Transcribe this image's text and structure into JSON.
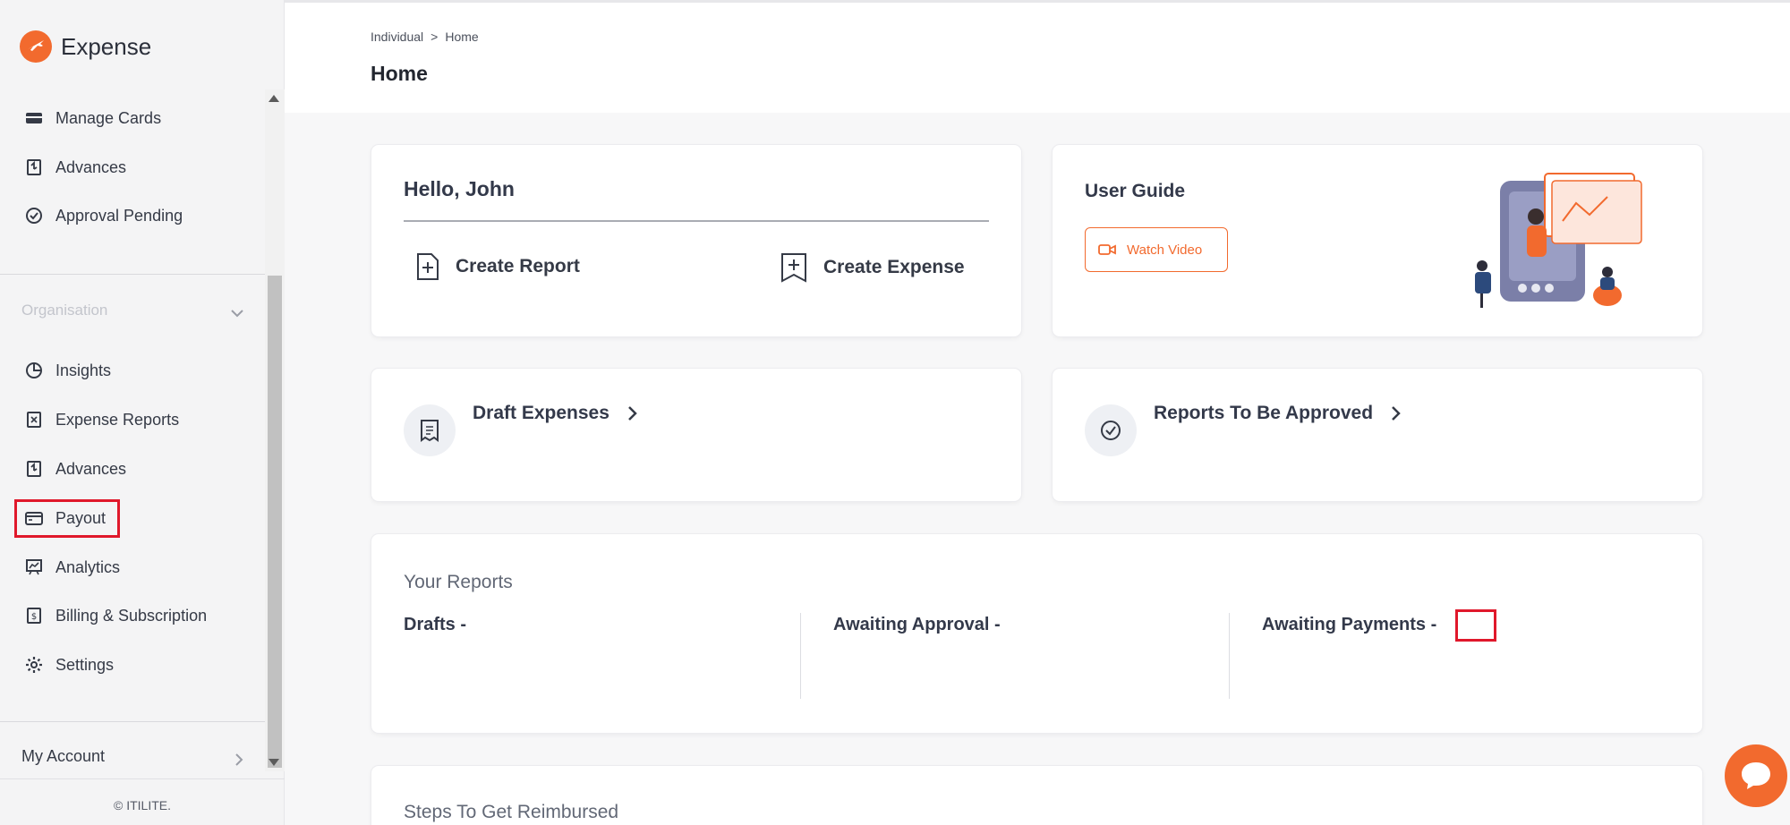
{
  "app": {
    "name": "Expense"
  },
  "sidebar": {
    "items_top": [
      {
        "label": "Manage Cards"
      },
      {
        "label": "Advances"
      },
      {
        "label": "Approval Pending"
      }
    ],
    "section_title": "Organisation",
    "items_org": [
      {
        "label": "Insights"
      },
      {
        "label": "Expense Reports"
      },
      {
        "label": "Advances"
      },
      {
        "label": "Payout"
      },
      {
        "label": "Analytics"
      },
      {
        "label": "Billing & Subscription"
      },
      {
        "label": "Settings"
      }
    ],
    "my_account": "My Account",
    "copyright": "© ITILITE."
  },
  "header": {
    "breadcrumb": [
      "Individual",
      ">",
      "Home"
    ],
    "title": "Home"
  },
  "hello_card": {
    "greeting": "Hello, John",
    "create_report": "Create Report",
    "create_expense": "Create Expense"
  },
  "guide_card": {
    "title": "User Guide",
    "watch_video": "Watch Video"
  },
  "draft_card": {
    "label": "Draft Expenses"
  },
  "approve_card": {
    "label": "Reports To Be Approved"
  },
  "reports": {
    "title": "Your Reports",
    "drafts": "Drafts -",
    "awaiting_approval": "Awaiting Approval -",
    "awaiting_payments": "Awaiting Payments -"
  },
  "steps": {
    "title": "Steps To Get Reimbursed"
  },
  "colors": {
    "accent": "#f26a2e",
    "highlight": "#e0182b"
  }
}
